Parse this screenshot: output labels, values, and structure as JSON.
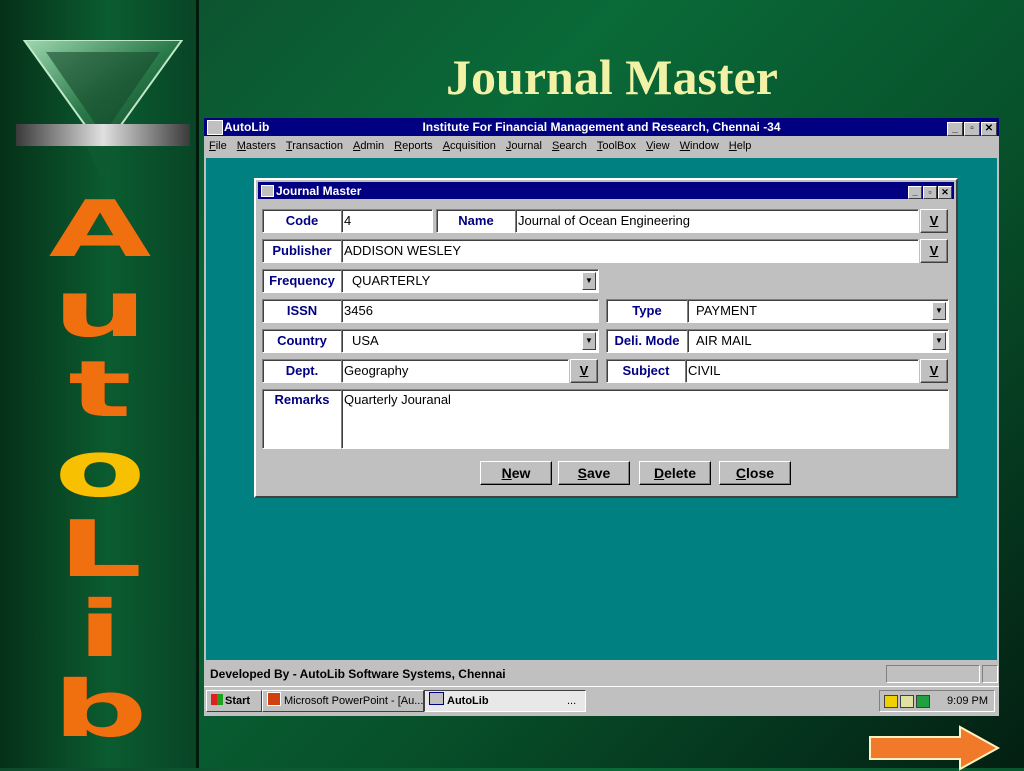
{
  "slide": {
    "title": "Journal Master",
    "vertical_letters": [
      "A",
      "u",
      "t",
      "o",
      "L",
      "i",
      "b"
    ]
  },
  "window": {
    "app_title": "AutoLib",
    "center_title": "Institute For Financial Management and Research, Chennai -34",
    "controls": [
      "_",
      "▫",
      "✕"
    ]
  },
  "menu": [
    "File",
    "Masters",
    "Transaction",
    "Admin",
    "Reports",
    "Acquisition",
    "Journal",
    "Search",
    "ToolBox",
    "View",
    "Window",
    "Help"
  ],
  "form": {
    "title": "Journal Master",
    "labels": {
      "code": "Code",
      "name": "Name",
      "publisher": "Publisher",
      "frequency": "Frequency",
      "issn": "ISSN",
      "type": "Type",
      "country": "Country",
      "deli_mode": "Deli. Mode",
      "dept": "Dept.",
      "subject": "Subject",
      "remarks": "Remarks"
    },
    "values": {
      "code": "4",
      "name": "Journal of Ocean Engineering",
      "publisher": "ADDISON WESLEY",
      "frequency": "QUARTERLY",
      "issn": "3456",
      "type": "PAYMENT",
      "country": "USA",
      "deli_mode": "AIR MAIL",
      "dept": "Geography",
      "subject": "CIVIL",
      "remarks": "Quarterly Jouranal"
    },
    "lookup_label": "V",
    "buttons": {
      "new": "New",
      "save": "Save",
      "delete": "Delete",
      "close": "Close"
    }
  },
  "status": {
    "text": "Developed By -  AutoLib Software Systems, Chennai"
  },
  "taskbar": {
    "start": "Start",
    "items": [
      "Microsoft PowerPoint - [Au...",
      "AutoLib"
    ],
    "ellipsis": "...",
    "clock": "9:09 PM"
  },
  "colors": {
    "accent": "#000080",
    "desktop": "#008080",
    "letters": "#f07010"
  }
}
